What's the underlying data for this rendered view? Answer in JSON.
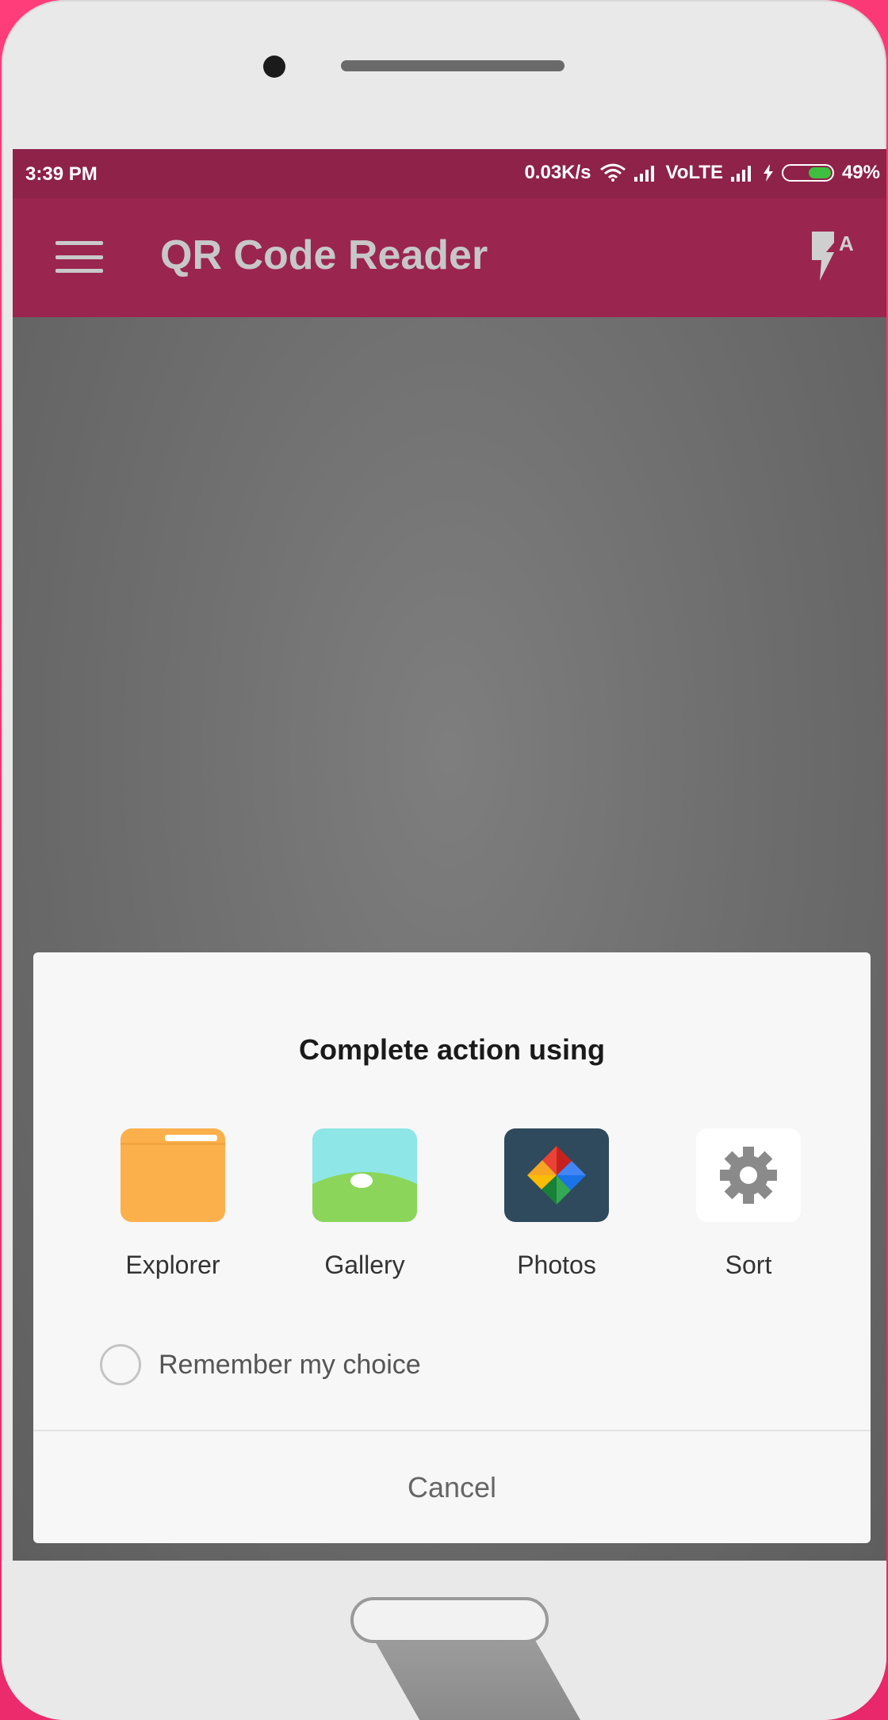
{
  "status_bar": {
    "time": "3:39 PM",
    "network_speed": "0.03K/s",
    "network_type": "VoLTE",
    "battery": "49%",
    "battery_level": 0.49
  },
  "app_bar": {
    "title": "QR Code Reader",
    "menu_icon": "hamburger-menu-icon",
    "flash_icon": "flash-auto-icon"
  },
  "dialog": {
    "title": "Complete action using",
    "apps": [
      {
        "label": "Explorer",
        "icon": "folder-icon",
        "color": "#FBB04B"
      },
      {
        "label": "Gallery",
        "icon": "gallery-landscape-icon",
        "color": "#8BD65A"
      },
      {
        "label": "Photos",
        "icon": "pinwheel-icon",
        "color": "#2E4A5C"
      },
      {
        "label": "Sort",
        "icon": "gear-icon",
        "color": "#FFFFFF"
      }
    ],
    "remember_label": "Remember my choice",
    "cancel_label": "Cancel"
  },
  "colors": {
    "app_bar": "#9A254F",
    "status_bar": "#8E2249",
    "background": "#F0306E"
  }
}
